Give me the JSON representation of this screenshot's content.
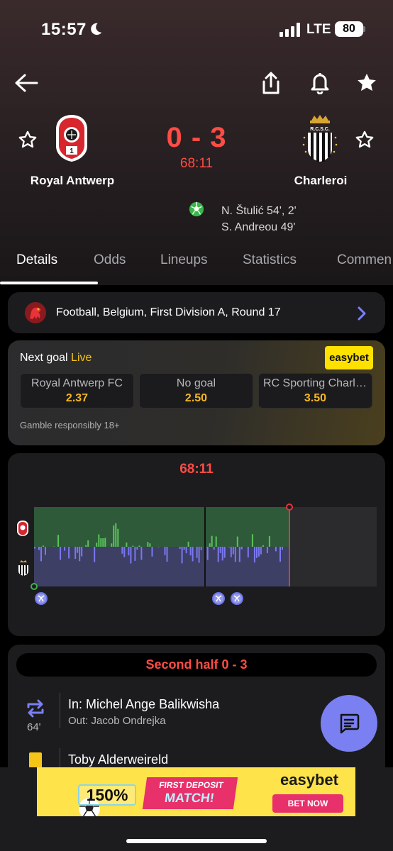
{
  "status_bar": {
    "time": "15:57",
    "network": "LTE",
    "battery": "80"
  },
  "match": {
    "home_team": "Royal Antwerp",
    "away_team": "Charleroi",
    "score": "0 - 3",
    "clock": "68:11",
    "scorers": [
      "N. Štulić 54', 2'",
      "S. Andreou 49'"
    ],
    "away_crest_text": "R.C.S.C."
  },
  "tabs": [
    "Details",
    "Odds",
    "Lineups",
    "Statistics",
    "Commen"
  ],
  "league": {
    "label": "Football, Belgium, First Division A, Round 17"
  },
  "odds": {
    "title": "Next goal",
    "live_label": "Live",
    "bookmaker": "easybet",
    "options": [
      {
        "label": "Royal Antwerp FC",
        "value": "2.37"
      },
      {
        "label": "No goal",
        "value": "2.50"
      },
      {
        "label": "RC Sporting Charle…",
        "value": "3.50"
      }
    ],
    "disclaimer": "Gamble responsibly 18+"
  },
  "momentum": {
    "time": "68:11",
    "colors": {
      "home": "#5cc25c",
      "away": "#7a78f0",
      "home_bg": "#2e5a3a",
      "away_bg": "#3d3f64",
      "marker": "#e8333a"
    }
  },
  "events": {
    "half_label": "Second half 0 - 3",
    "substitution": {
      "in_text": "In: Michel Ange Balikwisha",
      "out_text": "Out: Jacob Ondrejka",
      "minute": "64'"
    },
    "card": {
      "player": "Toby Alderweireld"
    }
  },
  "ad": {
    "bonus": "150%",
    "line1": "FIRST DEPOSIT",
    "line2": "MATCH!",
    "brand": "easybet",
    "cta": "BET NOW"
  }
}
